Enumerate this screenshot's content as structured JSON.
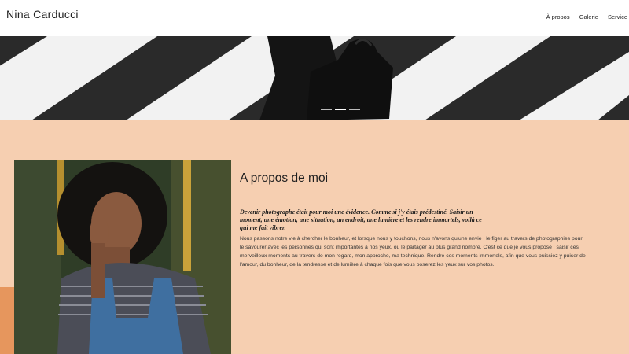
{
  "header": {
    "site_title": "Nina Carducci",
    "nav": [
      {
        "label": "À propos"
      },
      {
        "label": "Galerie"
      },
      {
        "label": "Service"
      }
    ]
  },
  "hero": {
    "slides_count": 3,
    "active_slide": 2
  },
  "about": {
    "heading": "A propos de moi",
    "intro": "Devenir photographe était pour moi une évidence. Comme si j'y étais prédestiné. Saisir un moment, une émotion, une situation, un endroit, une lumière et les rendre immortels, voilà ce qui me fait vibrer.",
    "body": "Nous passons notre vie à chercher le bonheur, et lorsque nous y touchons, nous n'avons qu'une envie : le figer au travers de photographies pour le savourer avec les personnes qui sont importantes à nos yeux, ou le partager au plus grand nombre. C'est ce que je vous propose : saisir ces merveilleux moments au travers de mon regard, mon approche, ma technique. Rendre ces moments immortels, afin que vous puissiez y puiser de l'amour, du bonheur, de la tendresse et de lumière à chaque fois que vous poserez les yeux sur vos photos."
  },
  "colors": {
    "background": "#f6cfb1",
    "accent": "#e6965d",
    "header_bg": "#ffffff",
    "text": "#333333"
  }
}
